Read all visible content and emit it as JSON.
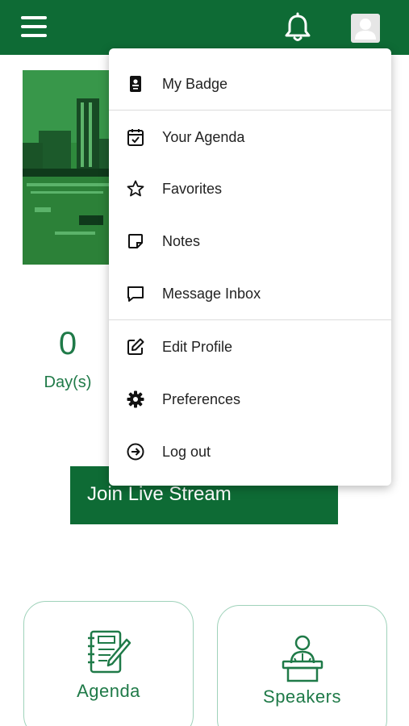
{
  "header": {
    "menu_icon": "hamburger-menu-icon",
    "notification_icon": "bell-icon",
    "profile_icon": "user-avatar-icon"
  },
  "hero": {
    "image": "city-skyline-image"
  },
  "countdown": {
    "value": "0",
    "unit": "Day(s)"
  },
  "live_stream": {
    "label": "Join Live Stream"
  },
  "cards": [
    {
      "label": "Agenda",
      "icon": "notebook-pencil-icon"
    },
    {
      "label": "Speakers",
      "icon": "speaker-podium-icon"
    }
  ],
  "menu": {
    "items": [
      {
        "label": "My Badge",
        "icon": "badge-icon"
      },
      {
        "label": "Your Agenda",
        "icon": "calendar-check-icon"
      },
      {
        "label": "Favorites",
        "icon": "star-icon"
      },
      {
        "label": "Notes",
        "icon": "note-icon"
      },
      {
        "label": "Message Inbox",
        "icon": "message-icon"
      },
      {
        "label": "Edit Profile",
        "icon": "edit-icon"
      },
      {
        "label": "Preferences",
        "icon": "gear-icon"
      },
      {
        "label": "Log out",
        "icon": "logout-icon"
      }
    ]
  },
  "colors": {
    "brand_green": "#0e6b35",
    "text_green": "#1f7a48",
    "card_border": "#9fd2ba"
  }
}
